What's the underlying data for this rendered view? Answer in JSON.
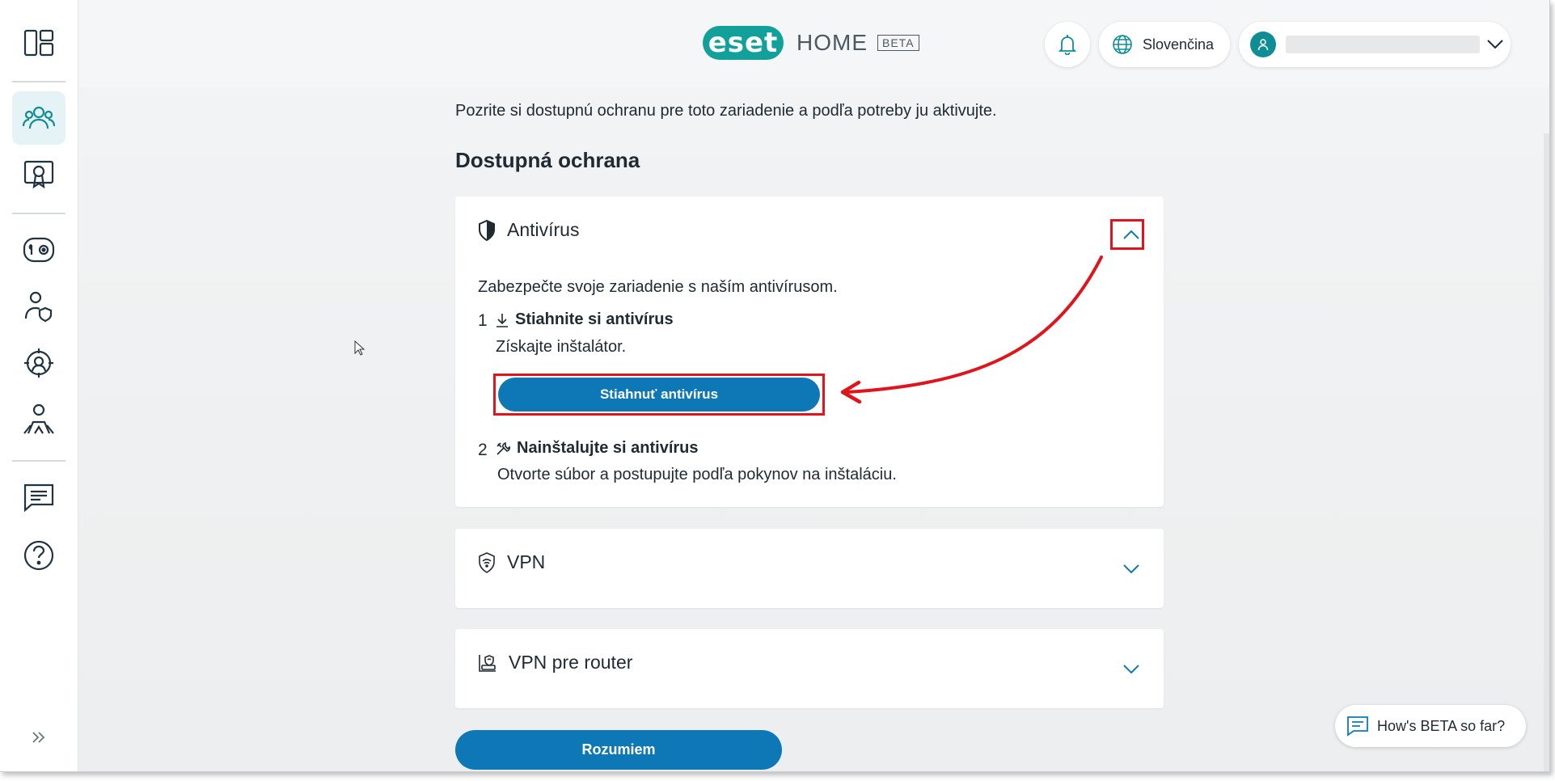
{
  "header": {
    "brand": "eset",
    "product": "HOME",
    "badge": "BETA",
    "language": "Slovenčina"
  },
  "sidebar": {
    "items": [
      {
        "icon": "dashboard-icon",
        "active": false
      },
      {
        "icon": "people-icon",
        "active": true
      },
      {
        "icon": "license-icon",
        "active": false
      },
      {
        "icon": "security-tools-icon",
        "active": false
      },
      {
        "icon": "user-protection-icon",
        "active": false
      },
      {
        "icon": "anti-theft-icon",
        "active": false
      },
      {
        "icon": "family-icon",
        "active": false
      },
      {
        "icon": "chat-icon",
        "active": false
      },
      {
        "icon": "help-icon",
        "active": false
      }
    ],
    "expand_icon": "double-chevron-right-icon"
  },
  "main": {
    "intro": "Pozrite si dostupnú ochranu pre toto zariadenie a podľa potreby ju aktivujte.",
    "section_title": "Dostupná ochrana",
    "cards": {
      "antivirus": {
        "title": "Antivírus",
        "expanded": true,
        "description": "Zabezpečte svoje zariadenie s naším antivírusom.",
        "step1": {
          "number": "1",
          "title": "Stiahnite si antivírus",
          "description": "Získajte inštalátor.",
          "button": "Stiahnuť antivírus"
        },
        "step2": {
          "number": "2",
          "title": "Nainštalujte si antivírus",
          "description": "Otvorte súbor a postupujte podľa pokynov na inštaláciu."
        }
      },
      "vpn": {
        "title": "VPN",
        "expanded": false
      },
      "router": {
        "title": "VPN pre router",
        "expanded": false
      }
    },
    "confirm_button": "Rozumiem"
  },
  "feedback": {
    "label": "How's BETA so far?"
  },
  "colors": {
    "accent": "#0e78b7",
    "brand": "#12a19a",
    "highlight": "#e0141c"
  }
}
